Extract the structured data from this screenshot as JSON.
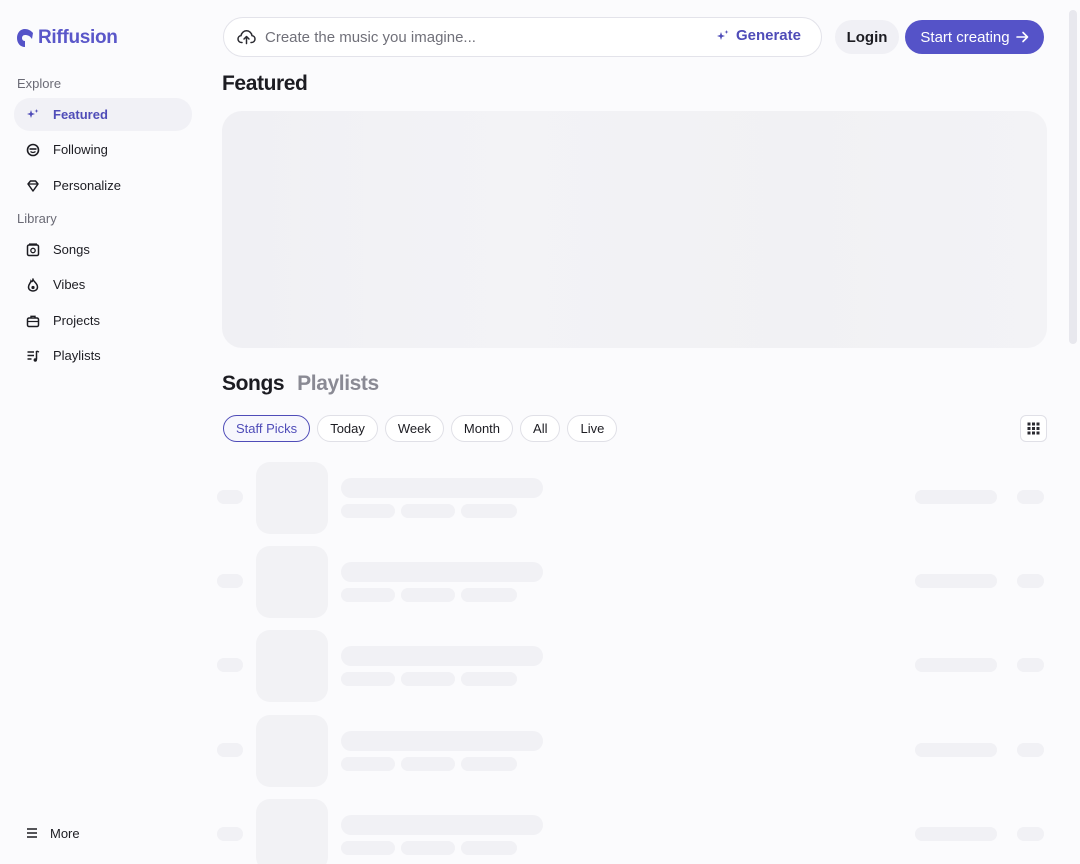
{
  "app": {
    "name": "Riffusion",
    "brand_color": "#5553c8"
  },
  "sidebar": {
    "explore_label": "Explore",
    "explore_items": [
      {
        "label": "Featured",
        "icon": "sparkle-icon",
        "active": true
      },
      {
        "label": "Following",
        "icon": "smile-icon",
        "active": false
      },
      {
        "label": "Personalize",
        "icon": "gem-icon",
        "active": false
      }
    ],
    "library_label": "Library",
    "library_items": [
      {
        "label": "Songs",
        "icon": "album-icon"
      },
      {
        "label": "Vibes",
        "icon": "flame-icon"
      },
      {
        "label": "Projects",
        "icon": "briefcase-icon"
      },
      {
        "label": "Playlists",
        "icon": "playlist-icon"
      }
    ],
    "more_label": "More"
  },
  "header": {
    "search_placeholder": "Create the music you imagine...",
    "generate_label": "Generate",
    "login_label": "Login",
    "start_label": "Start creating"
  },
  "main": {
    "featured_title": "Featured",
    "tabs": [
      {
        "label": "Songs",
        "active": true
      },
      {
        "label": "Playlists",
        "active": false
      }
    ],
    "filters": [
      {
        "label": "Staff Picks",
        "active": true
      },
      {
        "label": "Today",
        "active": false
      },
      {
        "label": "Week",
        "active": false
      },
      {
        "label": "Month",
        "active": false
      },
      {
        "label": "All",
        "active": false
      },
      {
        "label": "Live",
        "active": false
      }
    ]
  }
}
